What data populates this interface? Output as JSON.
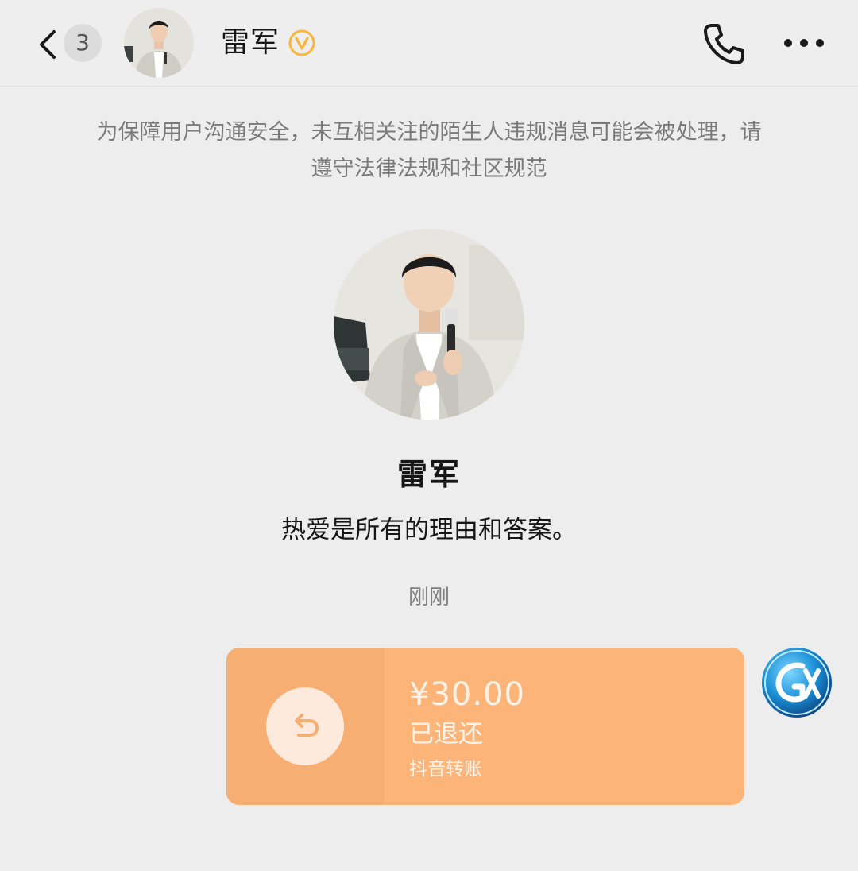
{
  "header": {
    "unread_count": "3",
    "contact_name": "雷军",
    "verified_icon": "verified-v-icon",
    "phone_icon": "phone-icon",
    "more_icon": "more-dots-icon"
  },
  "notice": {
    "text": "为保障用户沟通安全，未互相关注的陌生人违规消息可能会被处理，请遵守法律法规和社区规范"
  },
  "profile": {
    "name": "雷军",
    "signature": "热爱是所有的理由和答案。"
  },
  "conversation": {
    "timestamp": "刚刚",
    "transfer": {
      "amount": "¥30.00",
      "status": "已退还",
      "source": "抖音转账",
      "icon": "refund-return-icon"
    }
  },
  "colors": {
    "background": "#ededed",
    "transfer_bg": "#fdb478",
    "transfer_left_bg": "#f7ae72",
    "verified": "#f6b73c",
    "notice_text": "#7a7a7a"
  }
}
